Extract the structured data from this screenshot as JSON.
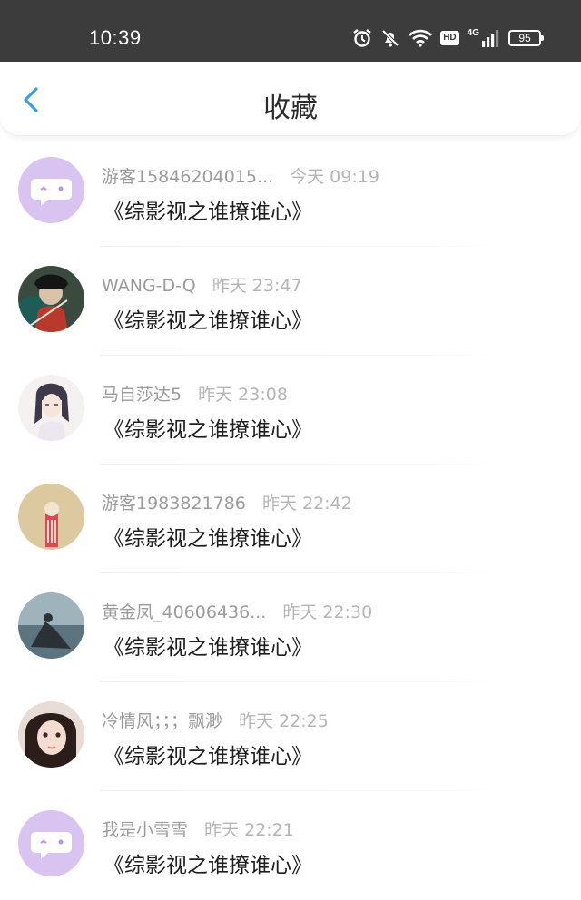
{
  "status_bar": {
    "time": "10:39",
    "hd": "HD",
    "network": "4G",
    "battery": "95",
    "icons": [
      "alarm-icon",
      "bell-muted-icon",
      "wifi-icon",
      "hd-icon",
      "signal-icon",
      "battery-icon"
    ]
  },
  "header": {
    "title": "收藏",
    "back_icon": "chevron-left-icon",
    "accent_color": "#3a9fdb"
  },
  "favorites": [
    {
      "username": "游客15846204015...",
      "time": "今天 09:19",
      "book": "《综影视之谁撩谁心》",
      "avatar": "default-avatar"
    },
    {
      "username": "WANG-D-Q",
      "time": "昨天 23:47",
      "book": "《综影视之谁撩谁心》",
      "avatar": "user-avatar"
    },
    {
      "username": "马自莎达5",
      "time": "昨天 23:08",
      "book": "《综影视之谁撩谁心》",
      "avatar": "user-avatar"
    },
    {
      "username": "游客1983821786",
      "time": "昨天 22:42",
      "book": "《综影视之谁撩谁心》",
      "avatar": "user-avatar"
    },
    {
      "username": "黄金凤_40606436...",
      "time": "昨天 22:30",
      "book": "《综影视之谁撩谁心》",
      "avatar": "user-avatar"
    },
    {
      "username": "冷情风；；；飘渺",
      "time": "昨天 22:25",
      "book": "《综影视之谁撩谁心》",
      "avatar": "user-avatar"
    },
    {
      "username": "我是小雪雪",
      "time": "昨天 22:21",
      "book": "《综影视之谁撩谁心》",
      "avatar": "default-avatar"
    }
  ],
  "colors": {
    "status_bar": "#3c3c3c",
    "default_avatar": "#d9c3f0",
    "username": "#9b9b9b",
    "timestamp": "#b5b5b5"
  }
}
